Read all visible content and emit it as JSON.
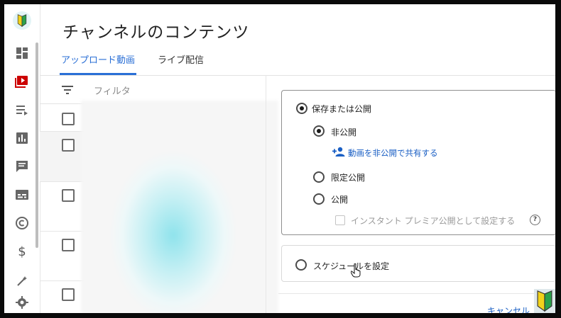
{
  "page": {
    "title": "チャンネルのコンテンツ"
  },
  "tabs": [
    {
      "label": "アップロード動画",
      "active": true
    },
    {
      "label": "ライブ配信",
      "active": false
    }
  ],
  "filter": {
    "placeholder": "フィルタ"
  },
  "sidebar": {
    "icons": [
      "beginner-mark-icon",
      "dashboard-icon",
      "content-icon",
      "playlist-icon",
      "analytics-icon",
      "comments-icon",
      "subtitles-icon",
      "copyright-icon",
      "monetization-icon",
      "customization-icon",
      "settings-icon"
    ]
  },
  "visibility": {
    "save_or_publish": "保存または公開",
    "private": "非公開",
    "share_private": "動画を非公開で共有する",
    "unlisted": "限定公開",
    "public": "公開",
    "premiere": "インスタント プレミア公開として設定する",
    "help": "?"
  },
  "schedule": {
    "label": "スケジュールを設定"
  },
  "footer": {
    "cancel": "キャンセル"
  },
  "colors": {
    "accent": "#2a6fd6",
    "link": "#1a5fc4",
    "content_red": "#cc0000"
  }
}
